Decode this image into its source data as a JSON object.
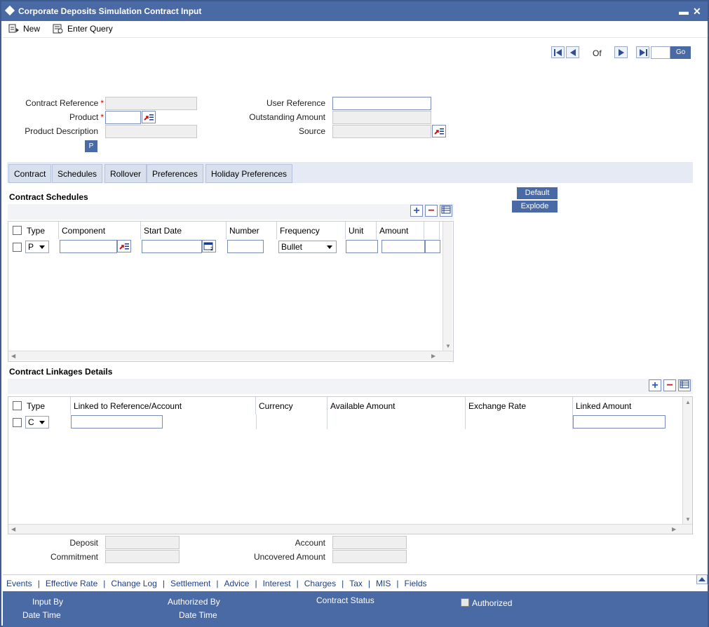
{
  "window": {
    "title": "Corporate Deposits Simulation Contract Input",
    "minimize": "▬",
    "close": "✕"
  },
  "toolbar": {
    "new_label": "New",
    "enter_query_label": "Enter Query"
  },
  "navigation": {
    "of_label": "Of",
    "go_label": "Go"
  },
  "header_form": {
    "contract_reference_label": "Contract Reference",
    "product_label": "Product",
    "product_description_label": "Product Description",
    "required_marker": "*",
    "p_button": "P",
    "user_reference_label": "User Reference",
    "outstanding_amount_label": "Outstanding Amount",
    "source_label": "Source"
  },
  "tabs": [
    "Contract",
    "Schedules",
    "Rollover",
    "Preferences",
    "Holiday Preferences"
  ],
  "schedules": {
    "section_title": "Contract Schedules",
    "default_button": "Default",
    "explode_button": "Explode",
    "columns": [
      "Type",
      "Component",
      "Start Date",
      "Number",
      "Frequency",
      "Unit",
      "Amount"
    ],
    "row": {
      "type": "P",
      "frequency": "Bullet"
    }
  },
  "linkages": {
    "section_title": "Contract Linkages Details",
    "columns": [
      "Type",
      "Linked to Reference/Account",
      "Currency",
      "Available Amount",
      "Exchange Rate",
      "Linked Amount"
    ],
    "row": {
      "type": "C"
    }
  },
  "summary": {
    "deposit_label": "Deposit",
    "commitment_label": "Commitment",
    "account_label": "Account",
    "uncovered_amount_label": "Uncovered Amount"
  },
  "footer_links": [
    "Events",
    "Effective Rate",
    "Change Log",
    "Settlement",
    "Advice",
    "Interest",
    "Charges",
    "Tax",
    "MIS",
    "Fields"
  ],
  "audit": {
    "input_by_label": "Input By",
    "date_time_label": "Date Time",
    "authorized_by_label": "Authorized By",
    "date_time_label_2": "Date Time",
    "contract_status_label": "Contract Status",
    "authorized_label": "Authorized"
  },
  "colors": {
    "brand_blue": "#4a6aa5",
    "tab_bg": "#d8e0ee",
    "required": "#cc0000"
  }
}
